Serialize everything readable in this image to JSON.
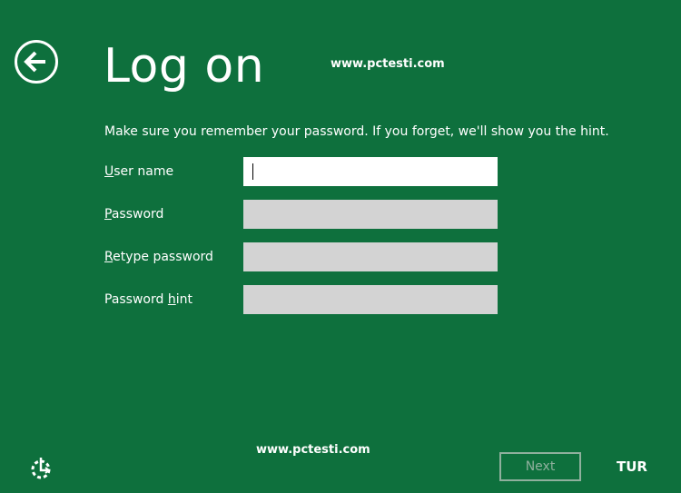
{
  "title": "Log on",
  "watermark": "www.pctesti.com",
  "instructions": "Make sure you remember your password. If you forget, we'll show you the hint.",
  "fields": [
    {
      "label_key": "U",
      "label_rest": "ser name",
      "value": ""
    },
    {
      "label_key": "P",
      "label_rest": "assword",
      "value": ""
    },
    {
      "label_key": "R",
      "label_rest": "etype password",
      "value": ""
    },
    {
      "label_pre": "Password ",
      "label_key": "h",
      "label_rest": "int",
      "value": ""
    }
  ],
  "buttons": {
    "next": "Next"
  },
  "language": "TUR",
  "icons": {
    "back": "back-arrow-icon",
    "accessibility": "ease-of-access-icon"
  },
  "colors": {
    "background": "#0e703d",
    "input_inactive": "#d3d3d3",
    "input_active": "#ffffff",
    "disabled_button": "#8fb09d"
  }
}
